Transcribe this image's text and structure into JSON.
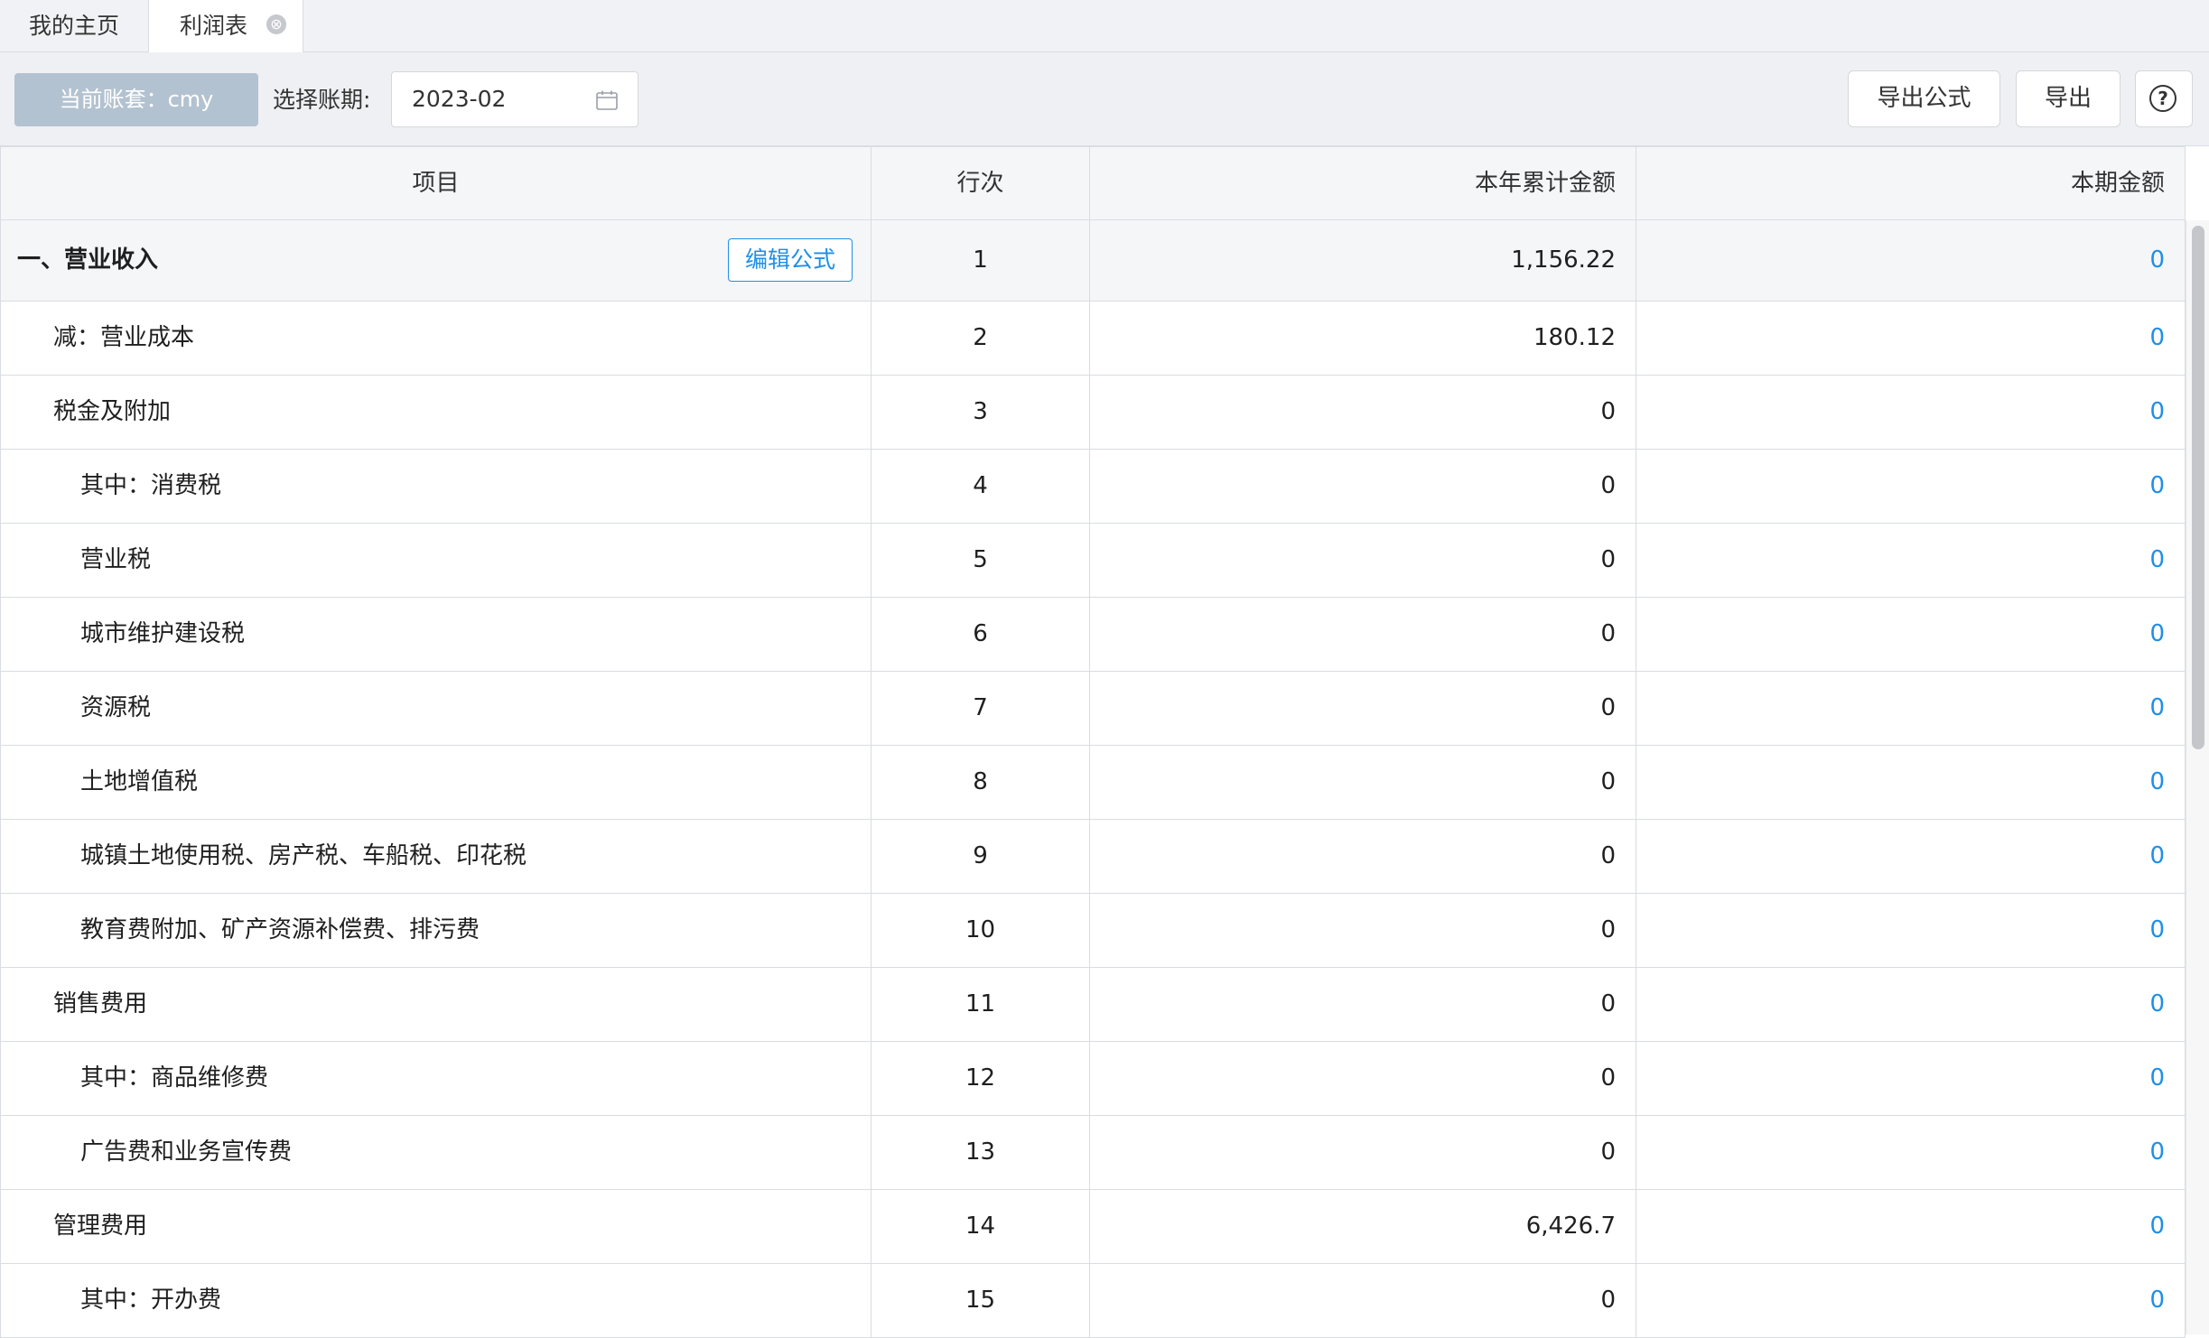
{
  "tabs": [
    {
      "label": "我的主页"
    },
    {
      "label": "利润表",
      "close": "⊗"
    }
  ],
  "toolbar": {
    "account": "当前账套：cmy",
    "period_label": "选择账期:",
    "period_value": "2023-02",
    "export_formula": "导出公式",
    "export": "导出",
    "help": "?"
  },
  "table": {
    "headers": [
      "项目",
      "行次",
      "本年累计金额",
      "本期金额"
    ],
    "edit_formula": "编辑公式",
    "rows": [
      {
        "item": "一、营业收入",
        "line": "1",
        "ytd": "1,156.22",
        "period": "0"
      },
      {
        "item": "减：营业成本",
        "line": "2",
        "ytd": "180.12",
        "period": "0"
      },
      {
        "item": "税金及附加",
        "line": "3",
        "ytd": "0",
        "period": "0"
      },
      {
        "item": "其中：消费税",
        "line": "4",
        "ytd": "0",
        "period": "0"
      },
      {
        "item": "营业税",
        "line": "5",
        "ytd": "0",
        "period": "0"
      },
      {
        "item": "城市维护建设税",
        "line": "6",
        "ytd": "0",
        "period": "0"
      },
      {
        "item": "资源税",
        "line": "7",
        "ytd": "0",
        "period": "0"
      },
      {
        "item": "土地增值税",
        "line": "8",
        "ytd": "0",
        "period": "0"
      },
      {
        "item": "城镇土地使用税、房产税、车船税、印花税",
        "line": "9",
        "ytd": "0",
        "period": "0"
      },
      {
        "item": "教育费附加、矿产资源补偿费、排污费",
        "line": "10",
        "ytd": "0",
        "period": "0"
      },
      {
        "item": "销售费用",
        "line": "11",
        "ytd": "0",
        "period": "0"
      },
      {
        "item": "其中：商品维修费",
        "line": "12",
        "ytd": "0",
        "period": "0"
      },
      {
        "item": "广告费和业务宣传费",
        "line": "13",
        "ytd": "0",
        "period": "0"
      },
      {
        "item": "管理费用",
        "line": "14",
        "ytd": "6,426.7",
        "period": "0"
      },
      {
        "item": "其中：开办费",
        "line": "15",
        "ytd": "0",
        "period": "0"
      }
    ]
  },
  "colors": {
    "accent": "#1f8fe6",
    "account_bg": "#b3c2d0"
  }
}
